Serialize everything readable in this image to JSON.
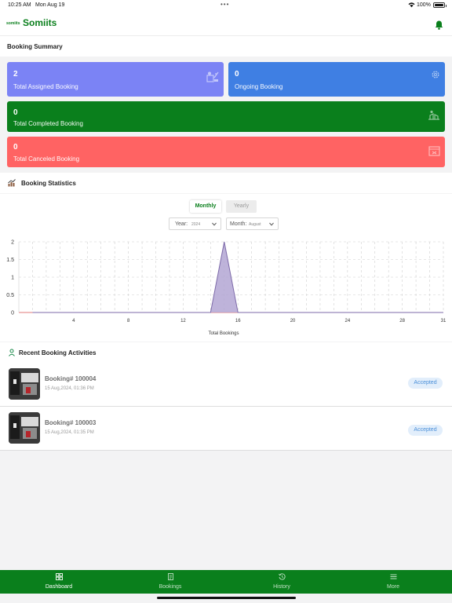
{
  "status_bar": {
    "time": "10:25 AM",
    "date": "Mon Aug 19",
    "battery": "100%"
  },
  "header": {
    "logo_small": "somiits",
    "app_name": "Somiits"
  },
  "summary": {
    "title": "Booking Summary",
    "cards": [
      {
        "value": "2",
        "label": "Total Assigned Booking",
        "color": "#7b83f5"
      },
      {
        "value": "0",
        "label": "Ongoing Booking",
        "color": "#3f7fe3"
      },
      {
        "value": "0",
        "label": "Total Completed Booking",
        "color": "#0a7f1c"
      },
      {
        "value": "0",
        "label": "Total Canceled Booking",
        "color": "#ff6363"
      }
    ]
  },
  "statistics": {
    "title": "Booking Statistics",
    "toggle": {
      "monthly": "Monthly",
      "yearly": "Yearly",
      "selected": "Monthly"
    },
    "year_select": {
      "label": "Year:",
      "value": "2024"
    },
    "month_select": {
      "label": "Month:",
      "value": "August"
    }
  },
  "chart_data": {
    "type": "area",
    "xlabel": "Total Bookings",
    "xlim": [
      0,
      31
    ],
    "ylim": [
      0,
      2
    ],
    "x_ticks": [
      4,
      8,
      12,
      16,
      20,
      24,
      28,
      31
    ],
    "y_ticks": [
      "0",
      "0.5",
      "1",
      "1.5",
      "2"
    ],
    "x": [
      1,
      2,
      3,
      4,
      5,
      6,
      7,
      8,
      9,
      10,
      11,
      12,
      13,
      14,
      15,
      16,
      17,
      18,
      19,
      20,
      21,
      22,
      23,
      24,
      25,
      26,
      27,
      28,
      29,
      30,
      31
    ],
    "series": [
      {
        "values": [
          0,
          0,
          0,
          0,
          0,
          0,
          0,
          0,
          0,
          0,
          0,
          0,
          0,
          0,
          2,
          0,
          0,
          0,
          0,
          0,
          0,
          0,
          0,
          0,
          0,
          0,
          0,
          0,
          0,
          0,
          0
        ]
      }
    ],
    "grid": true,
    "fill_color": "#b3a6d3",
    "line_color": "#7d6aa9"
  },
  "recent": {
    "title": "Recent Booking Activities",
    "items": [
      {
        "title": "Booking# 100004",
        "time": "15 Aug,2024, 01:36 PM",
        "status": "Accepted"
      },
      {
        "title": "Booking# 100003",
        "time": "15 Aug,2024, 01:35 PM",
        "status": "Accepted"
      }
    ]
  },
  "tabbar": {
    "items": [
      {
        "label": "Dashboard",
        "icon": "dashboard-icon"
      },
      {
        "label": "Bookings",
        "icon": "bookings-icon"
      },
      {
        "label": "History",
        "icon": "history-icon"
      },
      {
        "label": "More",
        "icon": "menu-icon"
      }
    ],
    "active": "Dashboard"
  }
}
